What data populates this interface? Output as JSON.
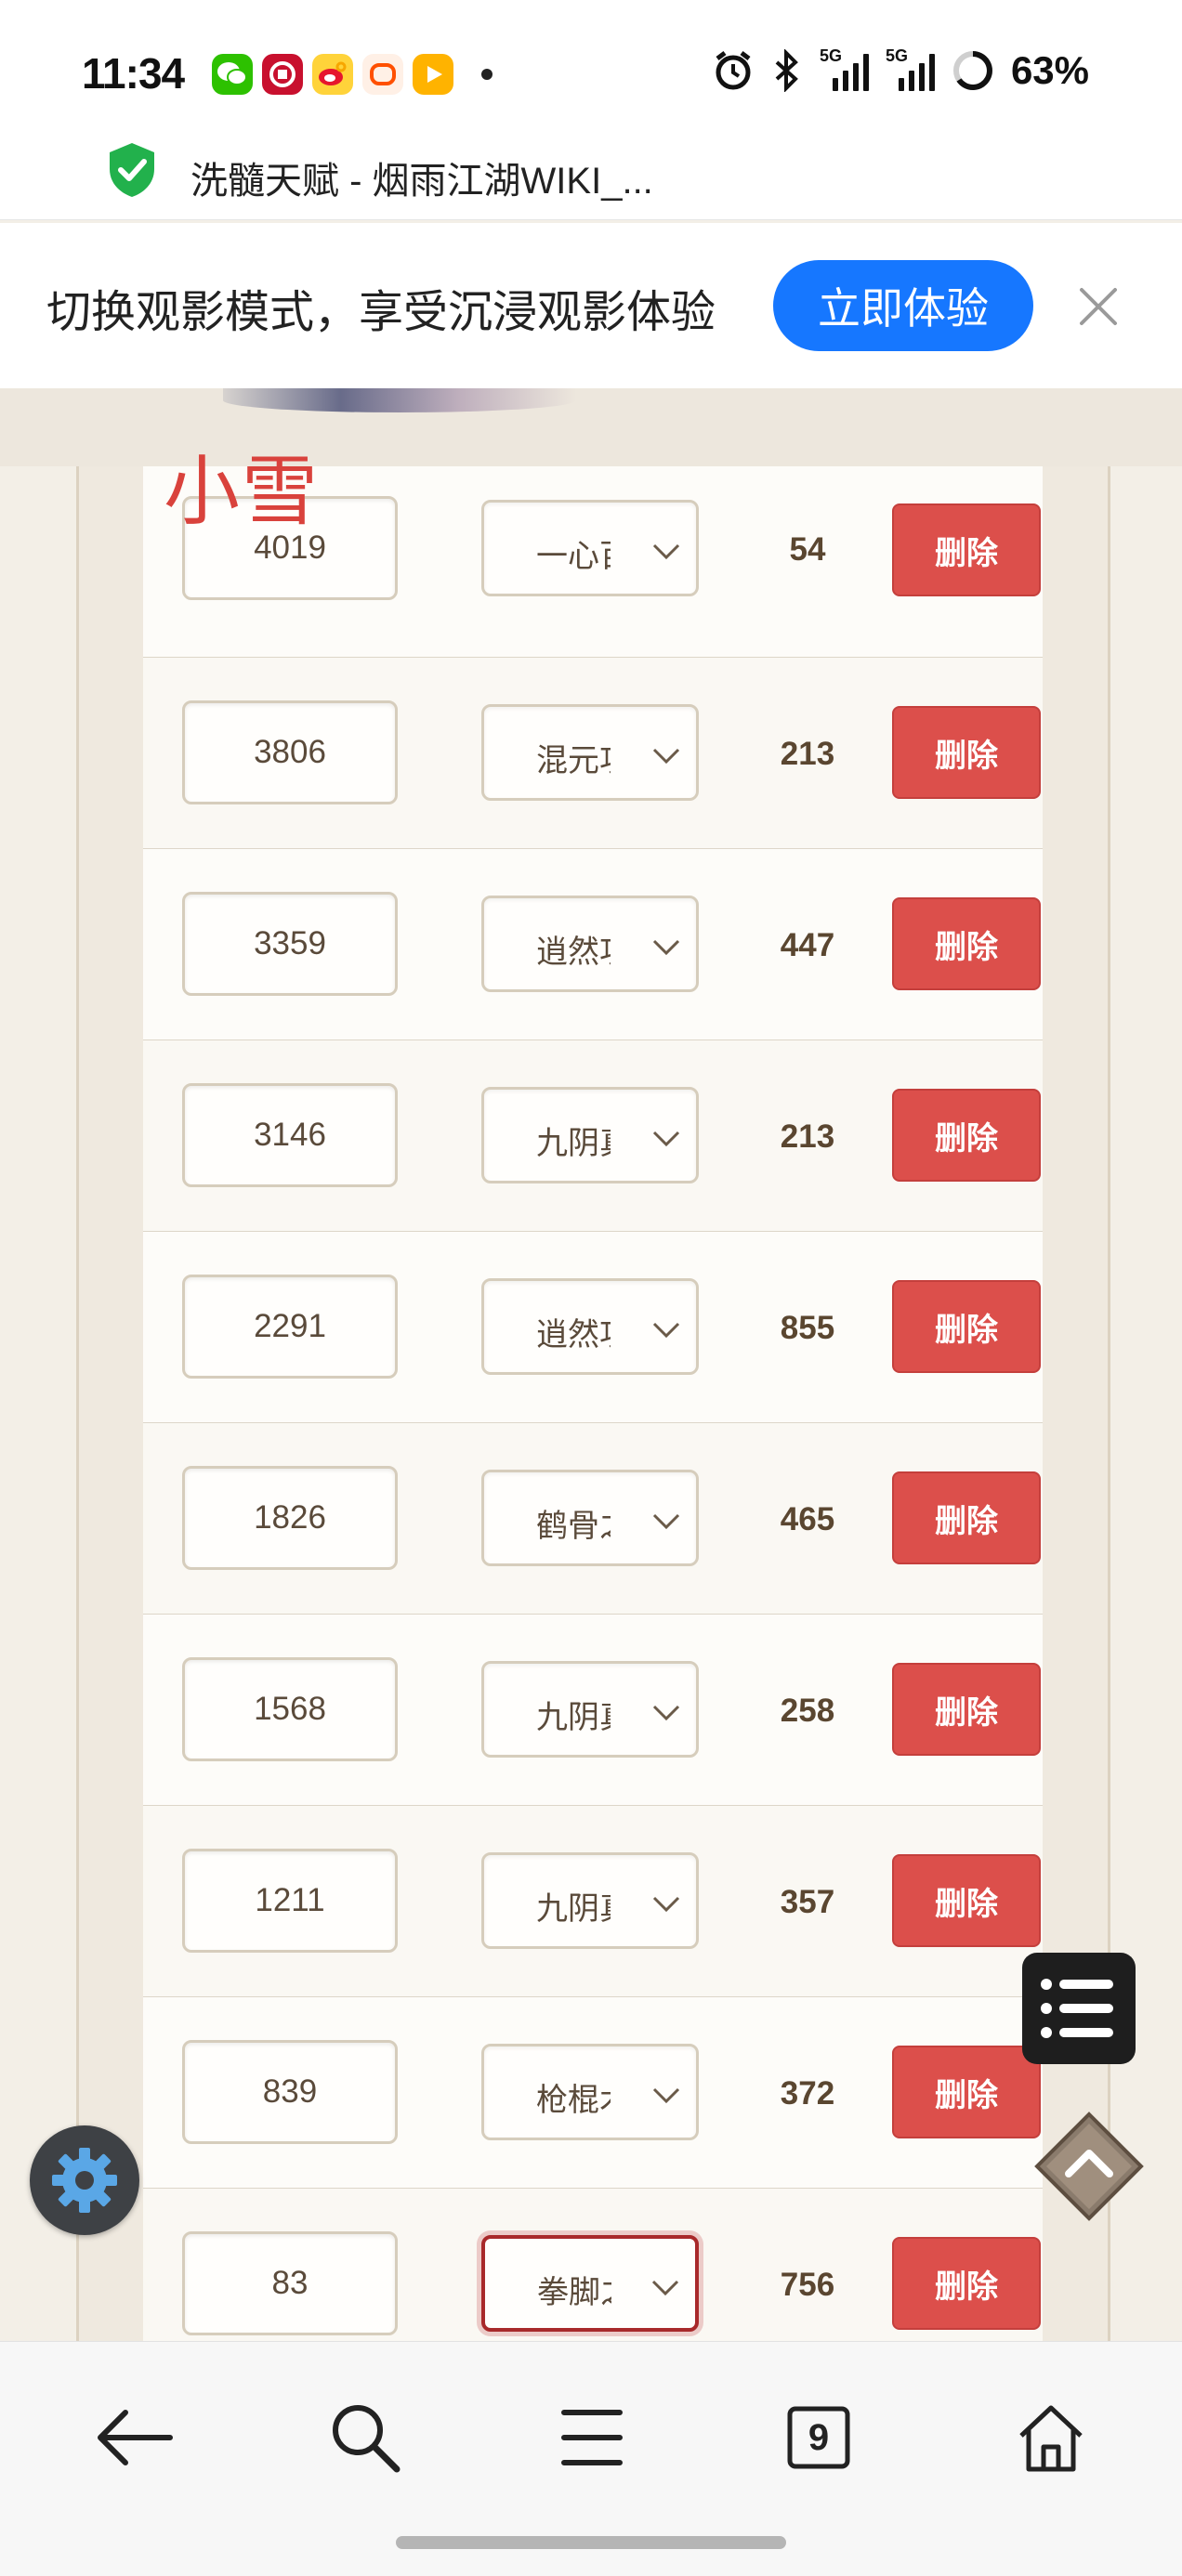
{
  "status_bar": {
    "time": "11:34",
    "battery": "63%",
    "app_icons": [
      "wechat-icon",
      "bank-icon",
      "weibo-icon",
      "taobao-icon",
      "video-app-icon"
    ],
    "network_label_1": "5G",
    "network_label_2": "5G"
  },
  "page": {
    "title": "洗髓天赋 - 烟雨江湖WIKI_..."
  },
  "banner": {
    "text": "切换观影模式，享受沉浸观影体验",
    "cta": "立即体验"
  },
  "header_label": "小雪",
  "rows": [
    {
      "id": "4019",
      "option": "一心百",
      "value": "54",
      "delete": "删除"
    },
    {
      "id": "3806",
      "option": "混元功",
      "value": "213",
      "delete": "删除"
    },
    {
      "id": "3359",
      "option": "逍然功",
      "value": "447",
      "delete": "删除"
    },
    {
      "id": "3146",
      "option": "九阴真",
      "value": "213",
      "delete": "删除"
    },
    {
      "id": "2291",
      "option": "逍然功",
      "value": "855",
      "delete": "删除"
    },
    {
      "id": "1826",
      "option": "鹤骨之",
      "value": "465",
      "delete": "删除"
    },
    {
      "id": "1568",
      "option": "九阴真",
      "value": "258",
      "delete": "删除"
    },
    {
      "id": "1211",
      "option": "九阴真",
      "value": "357",
      "delete": "删除"
    },
    {
      "id": "839",
      "option": "枪棍术",
      "value": "372",
      "delete": "删除"
    },
    {
      "id": "83",
      "option": "拳脚之",
      "value": "756",
      "delete": "删除"
    }
  ],
  "bottom_nav": {
    "tabs_count": "9"
  },
  "colors": {
    "accent_blue": "#1677ff",
    "delete_red": "#dc4f4b",
    "label_red": "#d9423c"
  }
}
